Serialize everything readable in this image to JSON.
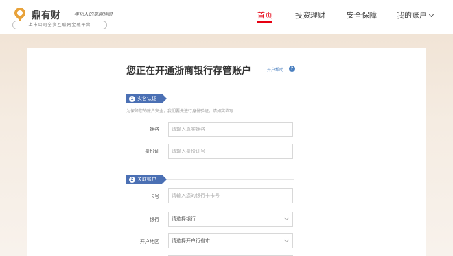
{
  "brand": {
    "name": "鼎有财",
    "slogan": "年化人的享趣理财",
    "sub": "上市公司全资互联网金融平台"
  },
  "nav": {
    "items": [
      {
        "label": "首页",
        "active": true
      },
      {
        "label": "投资理财",
        "active": false
      },
      {
        "label": "安全保障",
        "active": false
      },
      {
        "label": "我的账户",
        "active": false
      }
    ]
  },
  "page": {
    "title": "您正在开通浙商银行存管账户",
    "help_label": "开户帮助",
    "help_icon": "?"
  },
  "sections": [
    {
      "number": "1",
      "title": "实名认证",
      "note": "为保障您的账户安全，我们要先进行身份验证，请如实填写：",
      "fields": [
        {
          "label": "姓名",
          "placeholder": "请输入真实姓名"
        },
        {
          "label": "身份证",
          "placeholder": "请输入身份证号"
        }
      ]
    },
    {
      "number": "2",
      "title": "关联账户",
      "fields": [
        {
          "label": "卡号",
          "placeholder": "请输入您的银行卡卡号"
        }
      ],
      "selects": [
        {
          "label": "银行",
          "value": "请选择银行"
        },
        {
          "label": "开户地区",
          "value": "请选择开户行省市"
        }
      ]
    }
  ],
  "colors": {
    "accent_red": "#e60012",
    "section_blue": "#4b70b4",
    "logo_gold": "#e8a23a",
    "background_tan": "#f1e4d6"
  }
}
